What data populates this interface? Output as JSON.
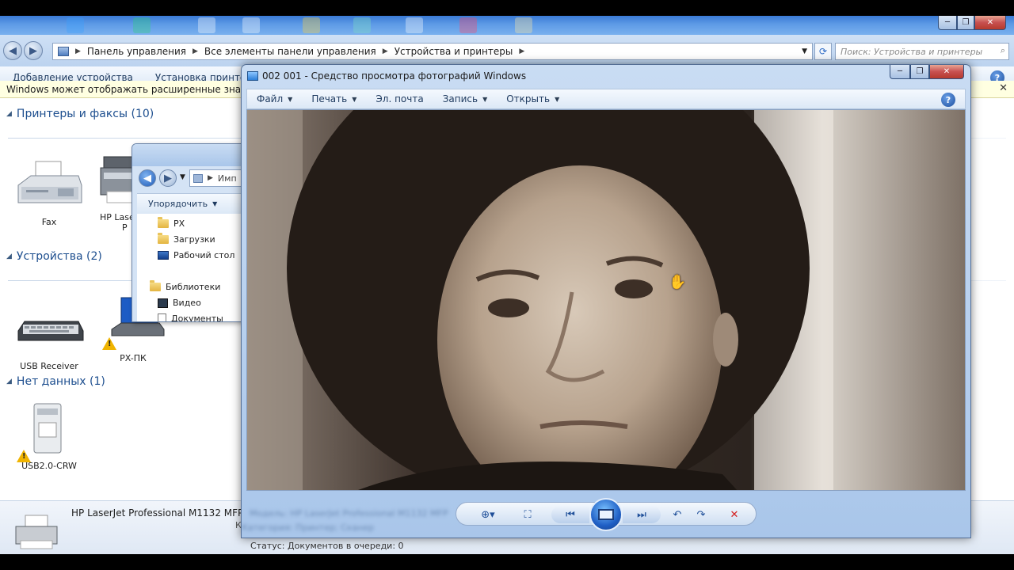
{
  "control_panel": {
    "breadcrumb": [
      "Панель управления",
      "Все элементы панели управления",
      "Устройства и принтеры"
    ],
    "search_placeholder": "Поиск: Устройства и принтеры",
    "toolbar": {
      "add_device": "Добавление устройства",
      "install_printer": "Установка принтера"
    },
    "info_bar": "Windows может отображать расширенные значки устро",
    "groups": {
      "printers": {
        "title": "Принтеры и факсы (10)",
        "devices": [
          {
            "name": "Fax"
          },
          {
            "name": "HP Laser",
            "name2": "P"
          }
        ]
      },
      "devices": {
        "title": "Устройства (2)",
        "devices": [
          {
            "name": "USB Receiver"
          },
          {
            "name": "PX-ПК"
          }
        ]
      },
      "nodata": {
        "title": "Нет данных (1)",
        "devices": [
          {
            "name": "USB2.0-CRW"
          }
        ]
      }
    },
    "details": {
      "device_name": "HP LaserJet Professional M1132 MFP",
      "status_line": "Статус: Документов в очереди: 0",
      "faded_label": "К"
    }
  },
  "explorer": {
    "address": "Имп",
    "organize": "Упорядочить",
    "tree": [
      {
        "icon": "folder-icon",
        "label": "PX"
      },
      {
        "icon": "folder-icon",
        "label": "Загрузки"
      },
      {
        "icon": "desktop-icon",
        "label": "Рабочий стол"
      },
      {
        "icon": "library-icon",
        "label": "Библиотеки"
      },
      {
        "icon": "video-icon",
        "label": "Видео"
      },
      {
        "icon": "document-icon",
        "label": "Документы"
      }
    ]
  },
  "viewer": {
    "title": "002 001 - Средство просмотра фотографий Windows",
    "menu": {
      "file": "Файл",
      "print": "Печать",
      "email": "Эл. почта",
      "burn": "Запись",
      "open": "Открыть"
    },
    "blurred_info_1": "Модель: HP LaserJet Professional M1132 MFP",
    "blurred_info_2": "Категория: Принтер; Сканер"
  },
  "colors": {
    "accent_blue": "#1e4f8f",
    "info_bar_bg": "#ffffe1",
    "delete_red": "#d32020",
    "photo_sepia": "#3a2e26"
  }
}
